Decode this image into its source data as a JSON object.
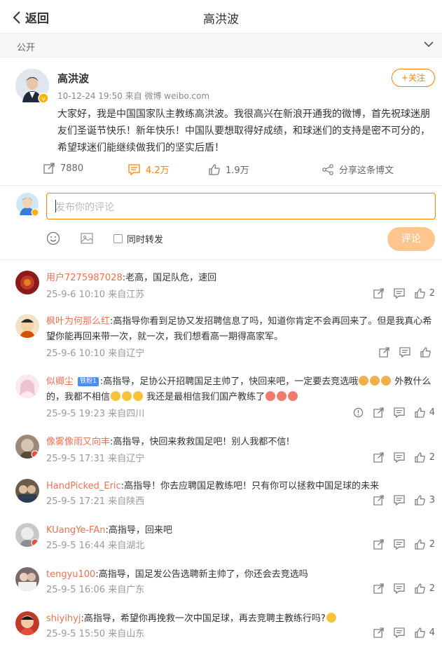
{
  "header": {
    "back_label": "返回",
    "title": "高洪波"
  },
  "visibility": {
    "label": "公开"
  },
  "post": {
    "author": "高洪波",
    "meta": "10-12-24 19:50  来自 微博 weibo.com",
    "follow_label": "+关注",
    "text": "大家好，我是中国国家队主教练高洪波。我很高兴在新浪开通我的微博，首先祝球迷朋友们圣诞节快乐！新年快乐！中国队要想取得好成绩，和球迷们的支持是密不可分的，希望球迷们能继续做我们的坚实后盾！",
    "reposts": "7880",
    "comments": "4.2万",
    "likes": "1.9万",
    "share_label": "分享这条博文"
  },
  "composer": {
    "placeholder": "发布你的评论",
    "repost_label": "同时转发",
    "submit_label": "评论"
  },
  "comments": [
    {
      "user": "用户7275987028",
      "text": ":老高，国足队危，速回",
      "meta": "25-9-6 10:10 来自江苏",
      "likes": "2",
      "avatar_color": "#8b1a1a"
    },
    {
      "user": "枫叶为何那么红",
      "text": ":高指导你看到足协又发招聘信息了吗，知道你肯定不会再回来了。但是我真心希望你能再回来带一次，就一次，我们想看高一期得高家军。",
      "meta": "25-9-6 10:10 来自辽宁",
      "likes": "",
      "avatar_color": "#c9a57a"
    },
    {
      "user": "似卿尘",
      "badge": "铁粉1",
      "text_a": ":高指导，足协公开招聘国足主帅了，快回来吧，一定要去竞选哦",
      "text_b": " 外教什么的，我都不相信",
      "text_c": " 我还是最相信我们国产教练了",
      "meta": "25-9-5 19:23 来自四川",
      "likes": "4",
      "avatar_color": "#f3d6e0"
    },
    {
      "user": "像雾像雨又向丰",
      "text": ":高指导，快回来救救国足吧！别人我都不信!",
      "meta": "25-9-5 17:31 来自辽宁",
      "likes": "2",
      "avatar_color": "#9a8a7a"
    },
    {
      "user": "HandPicked_Eric",
      "text": ":高指导！你去应聘国足教练吧！只有你可以拯救中国足球的未来",
      "meta": "25-9-5 17:21 来自陕西",
      "likes": "3",
      "avatar_color": "#6b5a4a"
    },
    {
      "user": "KUangYe-FAn",
      "text": ":高指导，回来吧",
      "meta": "25-9-5 16:44 来自湖北",
      "likes": "2",
      "avatar_color": "#b8b8b8"
    },
    {
      "user": "tengyu100",
      "text": ":高指导，国足发公告选聘新主帅了，你还会去竞选吗",
      "meta": "25-9-5 16:06 来自广东",
      "likes": "2",
      "avatar_color": "#7a6a6a"
    },
    {
      "user": "shiyihyj",
      "text": ":高指导，希望你再挽救一次中国足球，再去竞聘主教练行吗?",
      "meta": "25-9-5 15:50 来自山东",
      "likes": "4",
      "avatar_color": "#c0392b"
    }
  ],
  "colors": {
    "accent": "#ff8200",
    "username": "#eb7350"
  }
}
